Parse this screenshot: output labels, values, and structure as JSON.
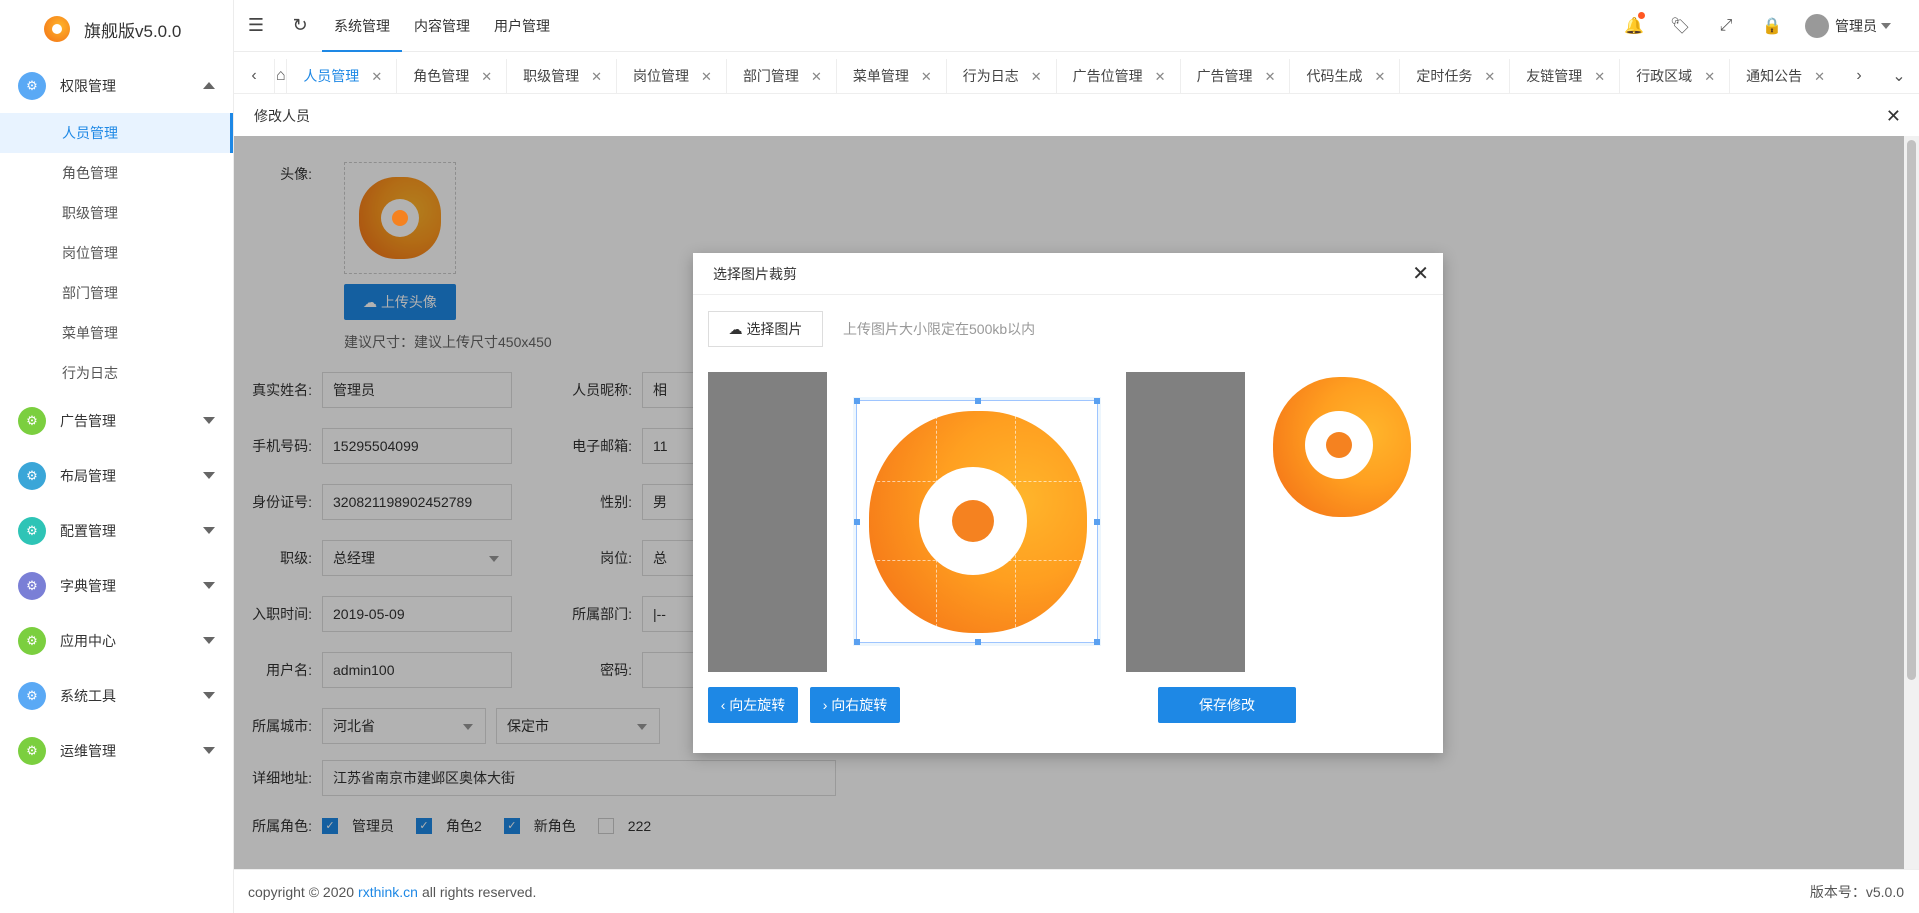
{
  "app": {
    "title": "旗舰版v5.0.0"
  },
  "sidebar": {
    "groups": [
      {
        "label": "权限管理",
        "icon": "gear-icon",
        "color": "#5aa9f5",
        "expanded": true,
        "items": [
          "人员管理",
          "角色管理",
          "职级管理",
          "岗位管理",
          "部门管理",
          "菜单管理",
          "行为日志"
        ]
      },
      {
        "label": "广告管理",
        "icon": "gear-icon",
        "color": "#7bcf3f"
      },
      {
        "label": "布局管理",
        "icon": "gear-icon",
        "color": "#3aa6d8"
      },
      {
        "label": "配置管理",
        "icon": "gear-icon",
        "color": "#2ec4b6"
      },
      {
        "label": "字典管理",
        "icon": "gear-icon",
        "color": "#7a7fd6"
      },
      {
        "label": "应用中心",
        "icon": "gear-icon",
        "color": "#7bcf3f"
      },
      {
        "label": "系统工具",
        "icon": "gear-icon",
        "color": "#5aa9f5"
      },
      {
        "label": "运维管理",
        "icon": "gear-icon",
        "color": "#7bcf3f"
      }
    ]
  },
  "topbar": {
    "nav": [
      "系统管理",
      "内容管理",
      "用户管理"
    ],
    "user": "管理员"
  },
  "tabs": [
    "人员管理",
    "角色管理",
    "职级管理",
    "岗位管理",
    "部门管理",
    "菜单管理",
    "行为日志",
    "广告位管理",
    "广告管理",
    "代码生成",
    "定时任务",
    "友链管理",
    "行政区域",
    "通知公告"
  ],
  "page": {
    "title": "修改人员"
  },
  "form": {
    "avatar_label": "头像:",
    "upload_btn": "上传头像",
    "hint": "建议尺寸：建议上传尺寸450x450",
    "realname_label": "真实姓名:",
    "realname": "管理员",
    "nickname_label": "人员昵称:",
    "nickname": "相",
    "phone_label": "手机号码:",
    "phone": "15295504099",
    "email_label": "电子邮箱:",
    "email": "11",
    "idcard_label": "身份证号:",
    "idcard": "320821198902452789",
    "gender_label": "性别:",
    "gender": "男",
    "level_label": "职级:",
    "level": "总经理",
    "position_label": "岗位:",
    "position": "总",
    "hiredate_label": "入职时间:",
    "hiredate": "2019-05-09",
    "dept_label": "所属部门:",
    "dept": "|--",
    "username_label": "用户名:",
    "username": "admin100",
    "password_label": "密码:",
    "city_label": "所属城市:",
    "province": "河北省",
    "city": "保定市",
    "address_label": "详细地址:",
    "address": "江苏省南京市建邺区奥体大街",
    "roles_label": "所属角色:",
    "roles": [
      {
        "name": "管理员",
        "checked": true
      },
      {
        "name": "角色2",
        "checked": true
      },
      {
        "name": "新角色",
        "checked": true
      },
      {
        "name": "222",
        "checked": false
      }
    ]
  },
  "modal": {
    "title": "选择图片裁剪",
    "pick_btn": "选择图片",
    "pick_hint": "上传图片大小限定在500kb以内",
    "rotate_left": "向左旋转",
    "rotate_right": "向右旋转",
    "save": "保存修改"
  },
  "footer": {
    "copyright": "copyright © 2020",
    "link": "rxthink.cn",
    "rights": "all rights reserved.",
    "version": "版本号：v5.0.0"
  },
  "colors": {
    "accent": "#1e88e5",
    "overlay": "rgba(0,0,0,0.3)"
  }
}
